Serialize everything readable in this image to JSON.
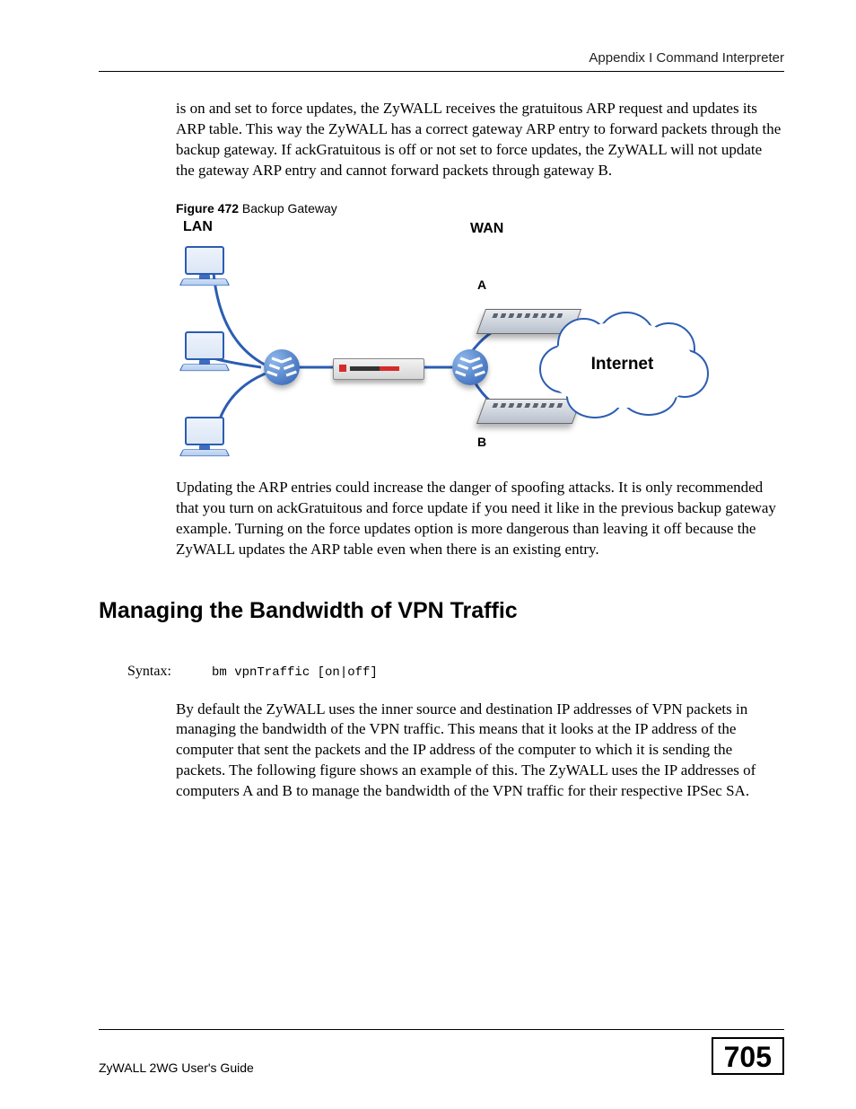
{
  "header": {
    "appendix": "Appendix I Command Interpreter"
  },
  "para1": "is on and set to force updates, the ZyWALL receives the gratuitous ARP request and updates its ARP table. This way the ZyWALL has a correct gateway ARP entry to forward packets through the backup gateway. If ackGratuitous is off or not set to force updates, the ZyWALL will not update the gateway ARP entry and cannot forward packets through gateway B.",
  "figure": {
    "caption_bold": "Figure 472",
    "caption_rest": "   Backup Gateway",
    "lan": "LAN",
    "wan": "WAN",
    "a": "A",
    "b": "B",
    "internet": "Internet"
  },
  "para2": "Updating the ARP entries could increase the danger of spoofing attacks. It is only recommended that you turn on ackGratuitous and force update if you need it like in the previous backup gateway example. Turning on the force updates option is more dangerous than leaving it off because the ZyWALL updates the ARP table even when there is an existing entry.",
  "heading2": "Managing the Bandwidth of VPN Traffic",
  "syntax": {
    "label": "Syntax:",
    "code": "bm vpnTraffic [on|off]"
  },
  "para3": "By default the ZyWALL uses the inner source and destination IP addresses of VPN packets in managing the bandwidth of the VPN traffic. This means that it looks at the IP address of the computer that sent the packets and the IP address of the computer to which it is sending the packets. The following figure shows an example of this. The ZyWALL uses the IP addresses of computers A and B to manage the bandwidth of the VPN traffic for their respective IPSec SA.",
  "footer": {
    "guide": "ZyWALL 2WG User's Guide",
    "page": "705"
  }
}
